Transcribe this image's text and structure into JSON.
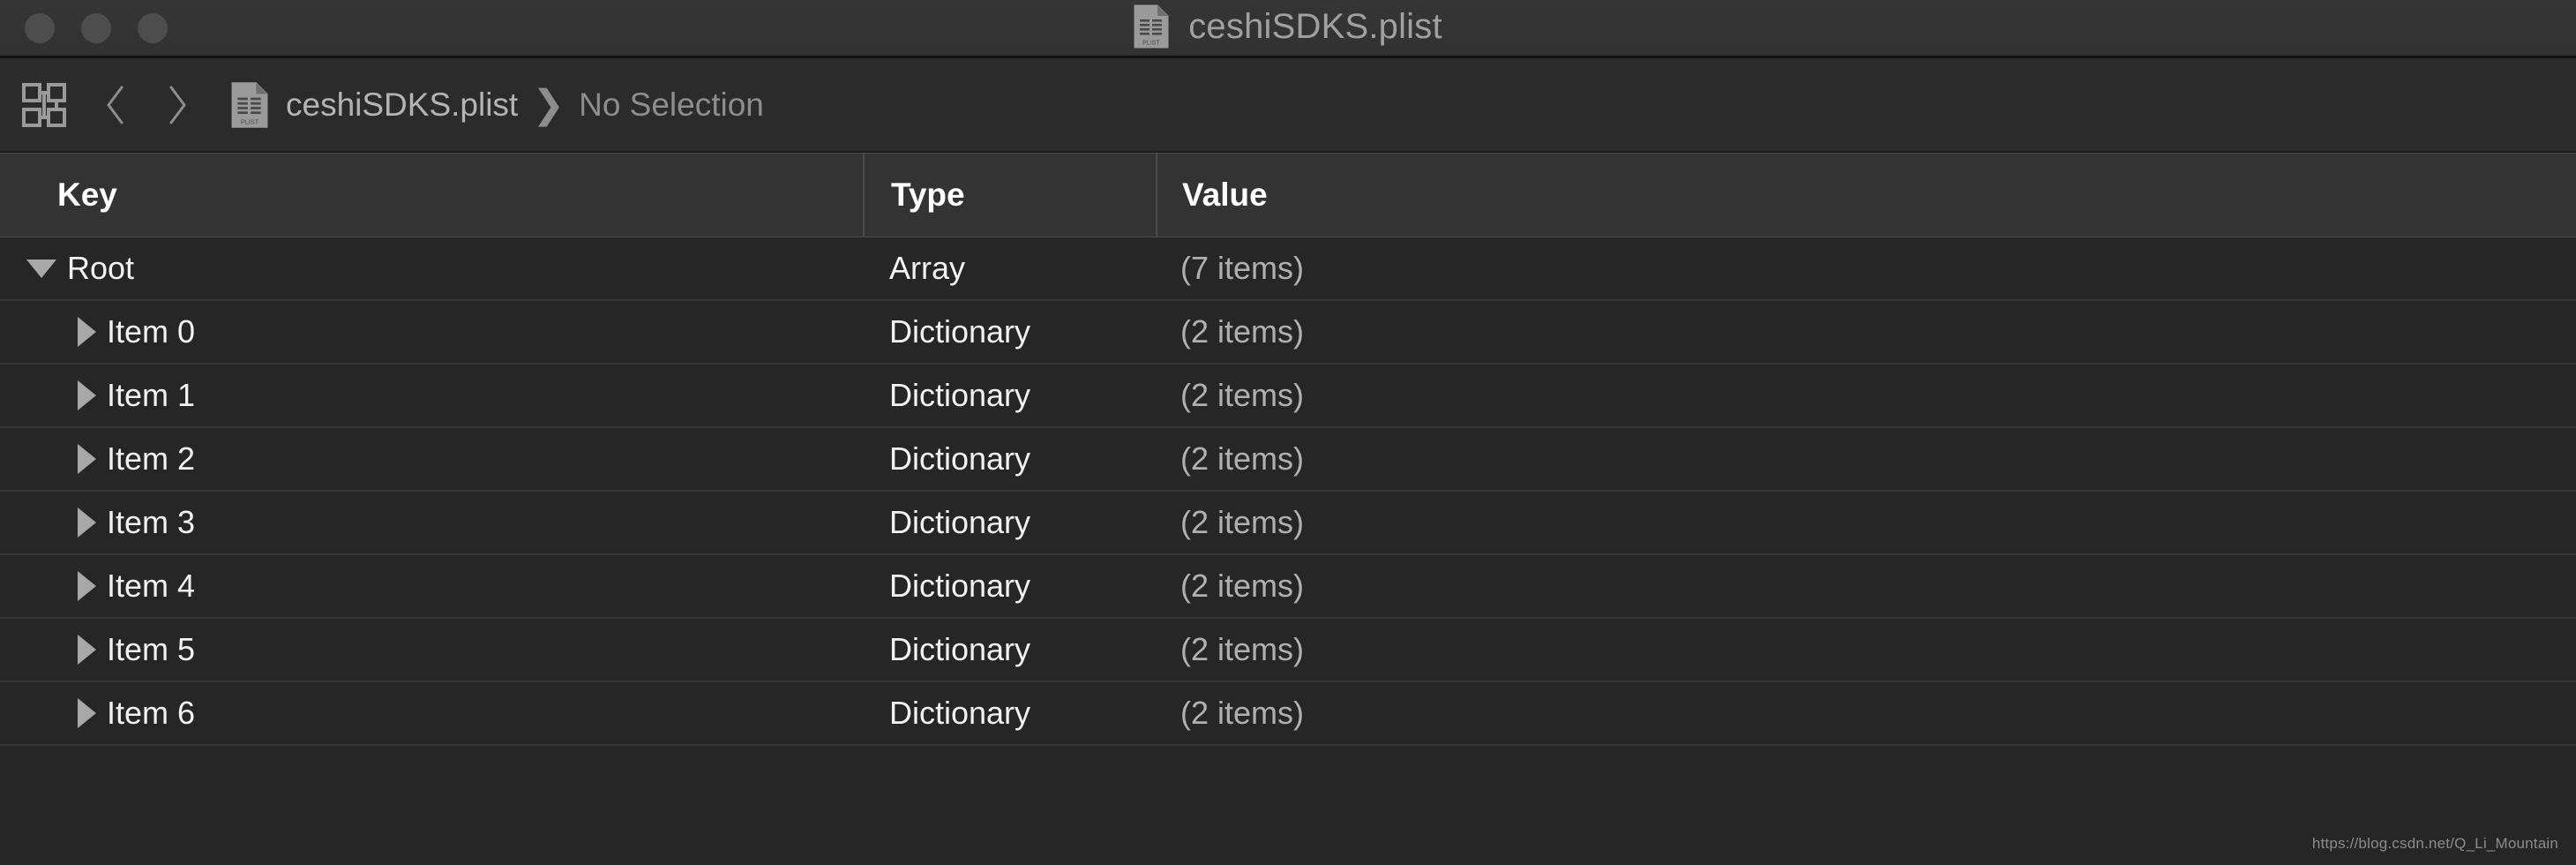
{
  "window": {
    "title": "ceshiSDKS.plist",
    "title_icon": "plist-document-icon",
    "traffic_lights": [
      {
        "name": "close-button",
        "color": "#4d4d4d"
      },
      {
        "name": "minimize-button",
        "color": "#4d4d4d"
      },
      {
        "name": "zoom-button",
        "color": "#4d4d4d"
      }
    ],
    "titlebar_color": "#333333"
  },
  "jumpbar": {
    "grid_icon": "related-items-grid-icon",
    "back_icon": "chevron-left-icon",
    "forward_icon": "chevron-right-icon",
    "file_icon": "plist-document-icon",
    "file_name": "ceshiSDKS.plist",
    "separator": "❯",
    "selection": "No Selection"
  },
  "table": {
    "columns": [
      "Key",
      "Type",
      "Value"
    ],
    "rows": [
      {
        "key": "Root",
        "type": "Array",
        "value": "(7 items)",
        "indent": 0,
        "disclosure": "expanded"
      },
      {
        "key": "Item 0",
        "type": "Dictionary",
        "value": "(2 items)",
        "indent": 1,
        "disclosure": "collapsed"
      },
      {
        "key": "Item 1",
        "type": "Dictionary",
        "value": "(2 items)",
        "indent": 1,
        "disclosure": "collapsed"
      },
      {
        "key": "Item 2",
        "type": "Dictionary",
        "value": "(2 items)",
        "indent": 1,
        "disclosure": "collapsed"
      },
      {
        "key": "Item 3",
        "type": "Dictionary",
        "value": "(2 items)",
        "indent": 1,
        "disclosure": "collapsed"
      },
      {
        "key": "Item 4",
        "type": "Dictionary",
        "value": "(2 items)",
        "indent": 1,
        "disclosure": "collapsed"
      },
      {
        "key": "Item 5",
        "type": "Dictionary",
        "value": "(2 items)",
        "indent": 1,
        "disclosure": "collapsed"
      },
      {
        "key": "Item 6",
        "type": "Dictionary",
        "value": "(2 items)",
        "indent": 1,
        "disclosure": "collapsed"
      }
    ]
  },
  "watermark": "https://blog.csdn.net/Q_Li_Mountain",
  "colors": {
    "background": "#262626",
    "header_background": "#333333",
    "toolbar_background": "#2b2b2b",
    "row_separator": "#363636",
    "key_text": "#f2f2f2",
    "value_text": "#b0b0b0",
    "crumb_text": "#b4b4b4"
  }
}
